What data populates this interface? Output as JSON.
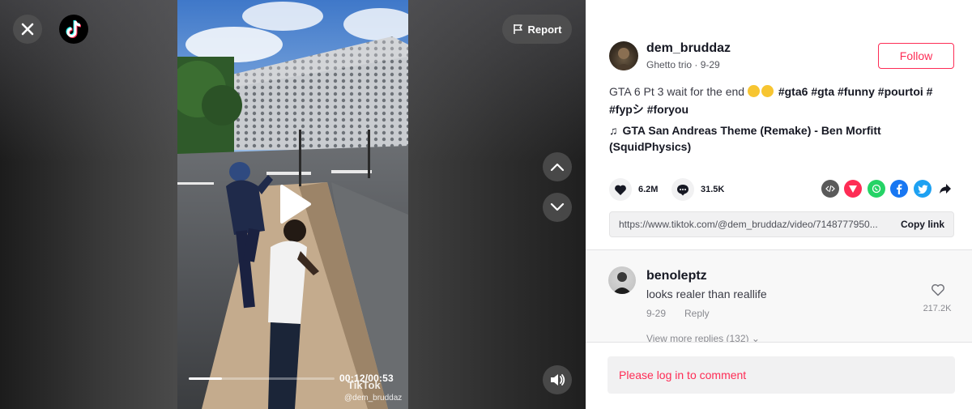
{
  "video": {
    "report_label": "Report",
    "time": "00:12/00:53",
    "progress": 0.23,
    "watermark_logo": "TikTok",
    "watermark_user": "@dem_bruddaz"
  },
  "author": {
    "username": "dem_bruddaz",
    "nickname": "Ghetto trio",
    "date": "9-29",
    "follow_label": "Follow"
  },
  "caption": {
    "text": "GTA 6 Pt 3 wait for the end",
    "hashtags": [
      "#gta6",
      "#gta",
      "#funny",
      "#pourtoi",
      "#",
      "#fypシ",
      "#foryou"
    ]
  },
  "music": {
    "title": "GTA San Andreas Theme (Remake) - Ben Morfitt (SquidPhysics)"
  },
  "stats": {
    "likes": "6.2M",
    "comments": "31.5K"
  },
  "share": {
    "icons": [
      "embed-icon",
      "send-icon",
      "whatsapp-icon",
      "facebook-icon",
      "twitter-icon",
      "share-arrow-icon"
    ],
    "colors": [
      "#5a5a5a",
      "#fe2c55",
      "#25d366",
      "#1877f2",
      "#1da1f2",
      "#161823"
    ]
  },
  "link": {
    "url": "https://www.tiktok.com/@dem_bruddaz/video/7148777950...",
    "copy_label": "Copy link"
  },
  "comment": {
    "username": "benoleptz",
    "text": "looks realer than reallife",
    "date": "9-29",
    "reply_label": "Reply",
    "likes": "217.2K",
    "more_replies": "View more replies (132)"
  },
  "login": {
    "prompt": "Please log in to comment"
  },
  "colors": {
    "accent": "#fe2c55",
    "panel_bg": "#ffffff",
    "comment_bg": "#f8f8f8"
  }
}
